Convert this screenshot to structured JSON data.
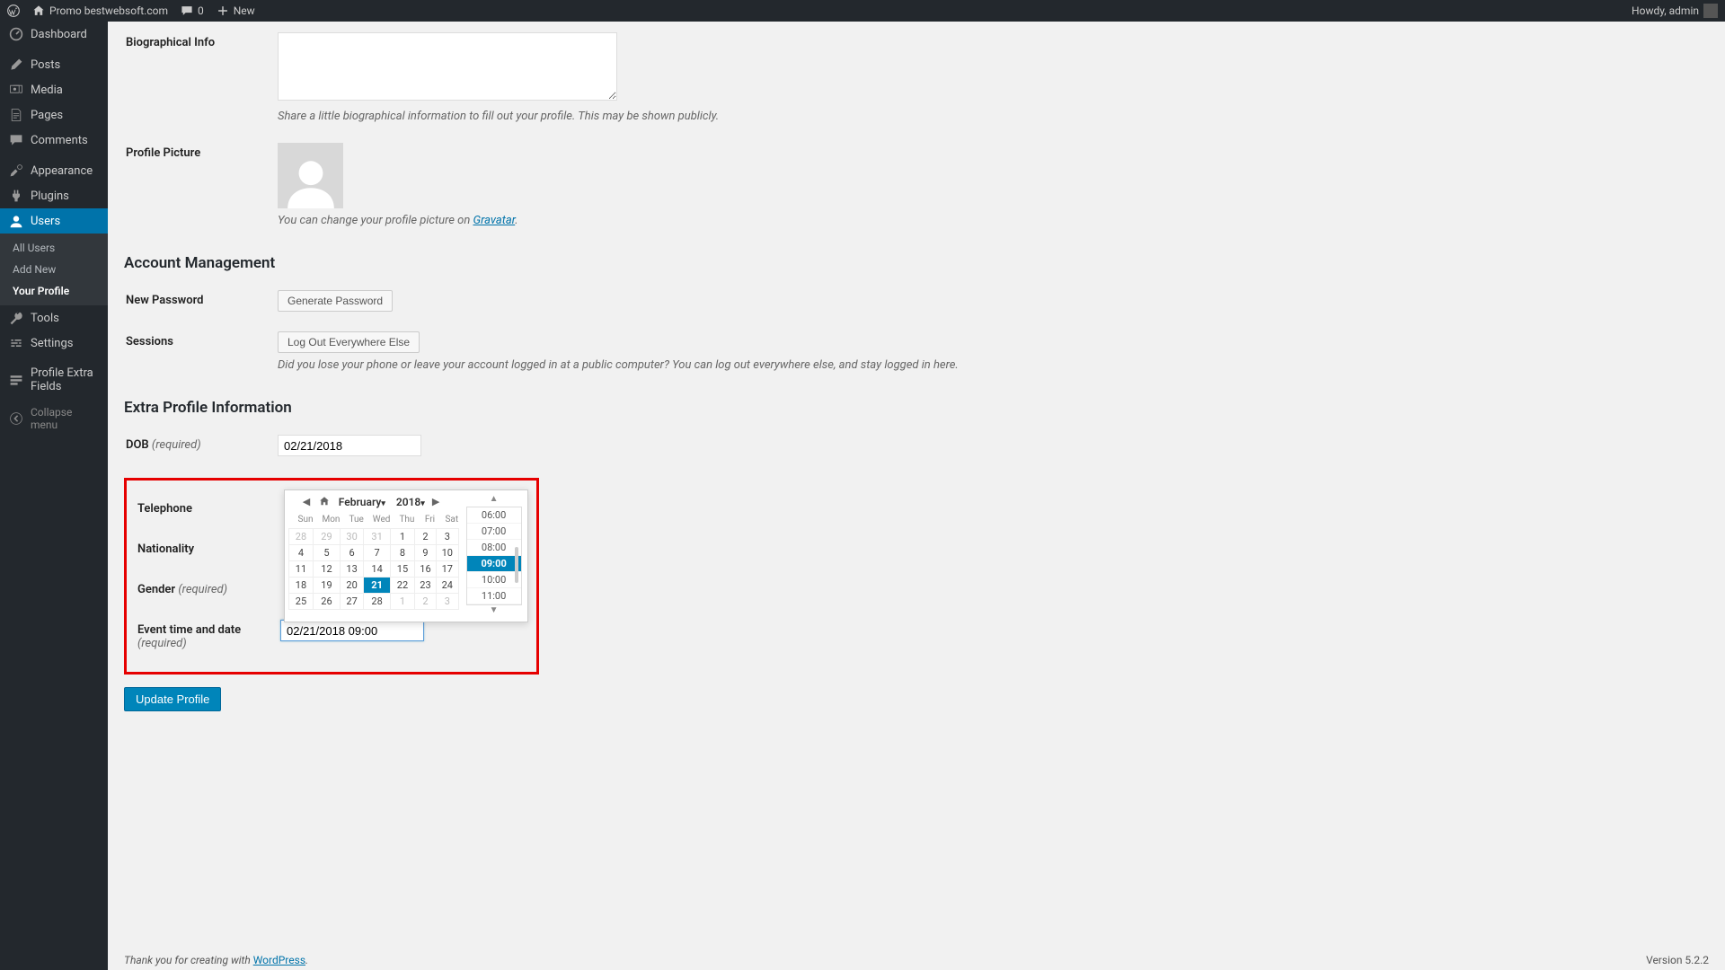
{
  "adminbar": {
    "site": "Promo bestwebsoft.com",
    "comments": "0",
    "new": "New",
    "howdy": "Howdy, admin"
  },
  "sidebar": {
    "dashboard": "Dashboard",
    "posts": "Posts",
    "media": "Media",
    "pages": "Pages",
    "comments": "Comments",
    "appearance": "Appearance",
    "plugins": "Plugins",
    "users": "Users",
    "users_sub": {
      "all": "All Users",
      "add": "Add New",
      "profile": "Your Profile"
    },
    "tools": "Tools",
    "settings": "Settings",
    "pef": "Profile Extra Fields",
    "collapse": "Collapse menu"
  },
  "form": {
    "bio_label": "Biographical Info",
    "bio_desc": "Share a little biographical information to fill out your profile. This may be shown publicly.",
    "pic_label": "Profile Picture",
    "pic_desc_pre": "You can change your profile picture on ",
    "pic_link": "Gravatar",
    "account_h": "Account Management",
    "newpw_label": "New Password",
    "genpw_btn": "Generate Password",
    "sessions_label": "Sessions",
    "logout_btn": "Log Out Everywhere Else",
    "logout_desc": "Did you lose your phone or leave your account logged in at a public computer? You can log out everywhere else, and stay logged in here.",
    "extra_h": "Extra Profile Information",
    "dob_label": "DOB",
    "dob_req": "(required)",
    "dob_val": "02/21/2018",
    "tel_label": "Telephone",
    "nat_label": "Nationality",
    "gen_label": "Gender",
    "gen_req": "(required)",
    "evt_label": "Event time and date",
    "evt_req": "(required)",
    "evt_val": "02/21/2018 09:00",
    "submit": "Update Profile"
  },
  "datepicker": {
    "month": "February",
    "year": "2018",
    "dows": [
      "Sun",
      "Mon",
      "Tue",
      "Wed",
      "Thu",
      "Fri",
      "Sat"
    ],
    "weeks": [
      [
        {
          "d": "28",
          "o": true
        },
        {
          "d": "29",
          "o": true
        },
        {
          "d": "30",
          "o": true
        },
        {
          "d": "31",
          "o": true
        },
        {
          "d": "1"
        },
        {
          "d": "2"
        },
        {
          "d": "3"
        }
      ],
      [
        {
          "d": "4"
        },
        {
          "d": "5"
        },
        {
          "d": "6"
        },
        {
          "d": "7"
        },
        {
          "d": "8"
        },
        {
          "d": "9"
        },
        {
          "d": "10"
        }
      ],
      [
        {
          "d": "11"
        },
        {
          "d": "12"
        },
        {
          "d": "13"
        },
        {
          "d": "14"
        },
        {
          "d": "15"
        },
        {
          "d": "16"
        },
        {
          "d": "17"
        }
      ],
      [
        {
          "d": "18"
        },
        {
          "d": "19"
        },
        {
          "d": "20"
        },
        {
          "d": "21",
          "sel": true
        },
        {
          "d": "22"
        },
        {
          "d": "23"
        },
        {
          "d": "24"
        }
      ],
      [
        {
          "d": "25"
        },
        {
          "d": "26"
        },
        {
          "d": "27"
        },
        {
          "d": "28"
        },
        {
          "d": "1",
          "o": true
        },
        {
          "d": "2",
          "o": true
        },
        {
          "d": "3",
          "o": true
        }
      ]
    ],
    "times": [
      {
        "t": "06:00"
      },
      {
        "t": "07:00"
      },
      {
        "t": "08:00"
      },
      {
        "t": "09:00",
        "sel": true
      },
      {
        "t": "10:00"
      },
      {
        "t": "11:00"
      }
    ]
  },
  "footer": {
    "thanks_pre": "Thank you for creating with ",
    "wp": "WordPress",
    "version": "Version 5.2.2"
  }
}
